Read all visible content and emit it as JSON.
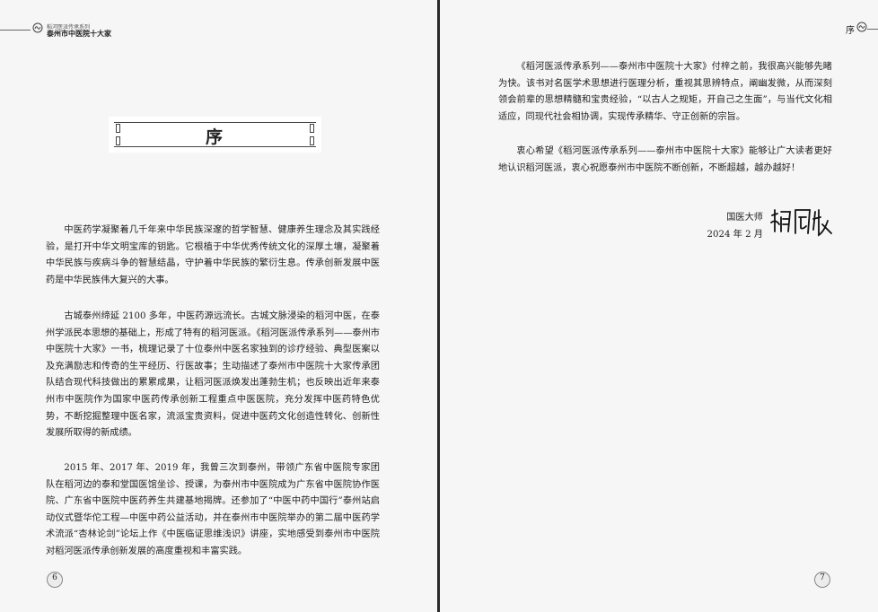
{
  "header_left": {
    "series": "稻河医派传承系列",
    "book_title": "泰州市中医院十大家"
  },
  "header_right": {
    "label": "序"
  },
  "title": "序",
  "left_page": {
    "paragraphs": [
      "中医药学凝聚着几千年来中华民族深邃的哲学智慧、健康养生理念及其实践经验，是打开中华文明宝库的钥匙。它根植于中华优秀传统文化的深厚土壤，凝聚着中华民族与疾病斗争的智慧结晶，守护着中华民族的繁衍生息。传承创新发展中医药是中华民族伟大复兴的大事。",
      "古城泰州缔延 2100 多年，中医药源远流长。古城文脉浸染的稻河中医，在泰州学派民本思想的基础上，形成了特有的稻河医派。《稻河医派传承系列——泰州市中医院十大家》一书，梳理记录了十位泰州中医名家独到的诊疗经验、典型医案以及充满励志和传奇的生平经历、行医故事；生动描述了泰州市中医院十大家传承团队结合现代科技做出的累累成果，让稻河医派焕发出蓬勃生机；也反映出近年来泰州市中医院作为国家中医药传承创新工程重点中医医院，充分发挥中医药特色优势，不断挖掘整理中医名家，流派宝贵资料，促进中医药文化创造性转化、创新性发展所取得的新成绩。",
      "2015 年、2017 年、2019 年，我曾三次到泰州，带领广东省中医院专家团队在稻河边的泰和堂国医馆坐诊、授课，为泰州市中医院成为广东省中医院协作医院、广东省中医院中医药养生共建基地揭牌。还参加了“中医中药中国行”泰州站启动仪式暨华佗工程—中医中药公益活动，并在泰州市中医院举办的第二届中医药学术流派“杏林论剑”论坛上作《中医临证思维浅识》讲座，实地感受到泰州市中医院对稻河医派传承创新发展的高度重视和丰富实践。"
    ],
    "page_number": "6"
  },
  "right_page": {
    "paragraphs": [
      "《稻河医派传承系列——泰州市中医院十大家》付梓之前，我很高兴能够先睹为快。该书对名医学术思想进行医理分析，重视其思辨特点，阐幽发微，从而深刻领会前辈的思想精髓和宝贵经验，“以古人之规矩，开自己之生面”，与当代文化相适应，同现代社会相协调，实现传承精华、守正创新的宗旨。",
      "衷心希望《稻河医派传承系列——泰州市中医院十大家》能够让广大读者更好地认识稻河医派，衷心祝愿泰州市中医院不断创新，不断超越，越办越好！"
    ],
    "signature": {
      "role": "国医大师",
      "date": "2024 年 2 月"
    },
    "page_number": "7"
  },
  "icons": {
    "header_logo": "cloud-ornament-icon",
    "signature": "handwritten-signature"
  },
  "colors": {
    "page_bg": "#f6f6f6",
    "spine": "#2a2a2a",
    "text": "#222222"
  }
}
